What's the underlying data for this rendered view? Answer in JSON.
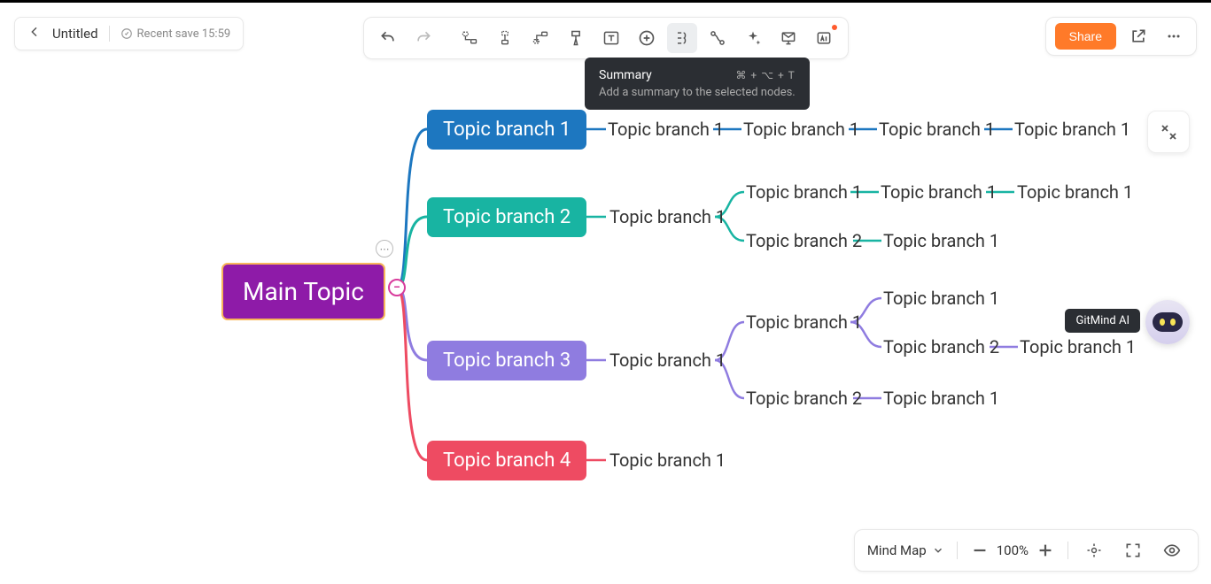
{
  "header": {
    "title": "Untitled",
    "save_label": "Recent save 15:59",
    "share_label": "Share"
  },
  "tooltip": {
    "title": "Summary",
    "shortcut": "⌘ + ⌥ + T",
    "desc": "Add a summary to the selected nodes."
  },
  "mindmap": {
    "root": "Main Topic",
    "branches": [
      {
        "label": "Topic branch 1",
        "children": [
          {
            "label": "Topic branch 1"
          },
          {
            "label": "Topic branch 1"
          },
          {
            "label": "Topic branch 1"
          },
          {
            "label": "Topic branch 1"
          }
        ]
      },
      {
        "label": "Topic branch 2",
        "children": [
          {
            "label": "Topic branch 1",
            "children": [
              {
                "label": "Topic branch 1",
                "children": [
                  {
                    "label": "Topic branch 1"
                  },
                  {
                    "label": "Topic branch 1"
                  }
                ]
              },
              {
                "label": "Topic branch 2",
                "children": [
                  {
                    "label": "Topic branch 1"
                  }
                ]
              }
            ]
          }
        ]
      },
      {
        "label": "Topic branch 3",
        "children": [
          {
            "label": "Topic branch 1",
            "children": [
              {
                "label": "Topic branch 1",
                "children": [
                  {
                    "label": "Topic branch 1"
                  },
                  {
                    "label": "Topic branch 2",
                    "children": [
                      {
                        "label": "Topic branch 1"
                      }
                    ]
                  }
                ]
              },
              {
                "label": "Topic branch 2",
                "children": [
                  {
                    "label": "Topic branch 1"
                  }
                ]
              }
            ]
          }
        ]
      },
      {
        "label": "Topic branch 4",
        "children": [
          {
            "label": "Topic branch 1"
          }
        ]
      }
    ]
  },
  "ai": {
    "badge": "GitMind AI"
  },
  "bottom": {
    "layout": "Mind Map",
    "zoom": "100%"
  },
  "colors": {
    "root": "#8e1ba8",
    "b1": "#1d77c0",
    "b2": "#18b4a2",
    "b3": "#8f7ce0",
    "b4": "#ee4b62"
  }
}
